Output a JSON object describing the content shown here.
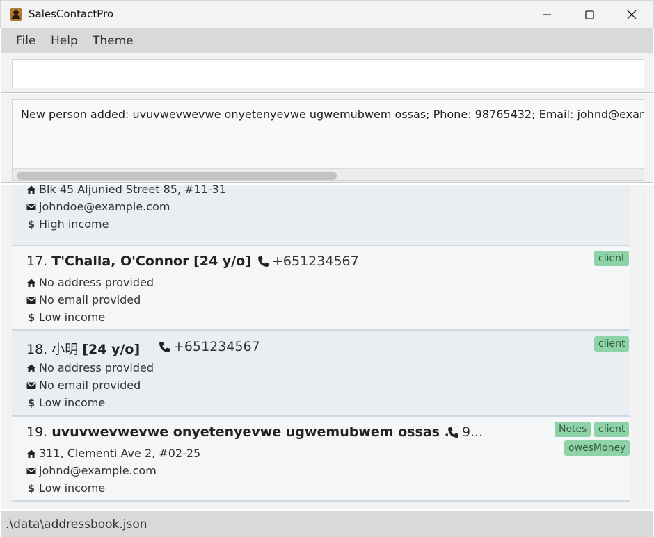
{
  "window": {
    "title": "SalesContactPro"
  },
  "menu": {
    "file": "File",
    "help": "Help",
    "theme": "Theme"
  },
  "command": {
    "value": ""
  },
  "result": {
    "message": "New person added: uvuvwevwevwe onyetenyevwe ugwemubwem ossas; Phone: 98765432; Email: johnd@example.com"
  },
  "persons": [
    {
      "address": "Blk 45 Aljunied Street 85, #11-31",
      "email": "johndoe@example.com",
      "income": "High income"
    },
    {
      "index": "17.",
      "name": "T'Challa, O'Connor [24 y/o]",
      "phone": "+651234567",
      "address": "No address provided",
      "email": "No email provided",
      "income": "Low income",
      "tags": [
        "client"
      ]
    },
    {
      "index": "18.",
      "name_plain": "小明",
      "name_bold": "[24 y/o]",
      "phone": "+651234567",
      "address": "No address provided",
      "email": "No email provided",
      "income": "Low income",
      "tags": [
        "client"
      ]
    },
    {
      "index": "19.",
      "name": "uvuvwevwevwe onyetenyevwe ugwemubwem ossas ...",
      "phone": "9...",
      "address": "311, Clementi Ave 2, #02-25",
      "email": "johnd@example.com",
      "income": "Low income",
      "tags": [
        "Notes",
        "client",
        "owesMoney"
      ]
    }
  ],
  "status": {
    "path": ".\\data\\addressbook.json"
  },
  "colors": {
    "tag_bg": "#8ed3a8",
    "card_even": "#e9eef3",
    "card_odd": "#f5f6f7"
  }
}
